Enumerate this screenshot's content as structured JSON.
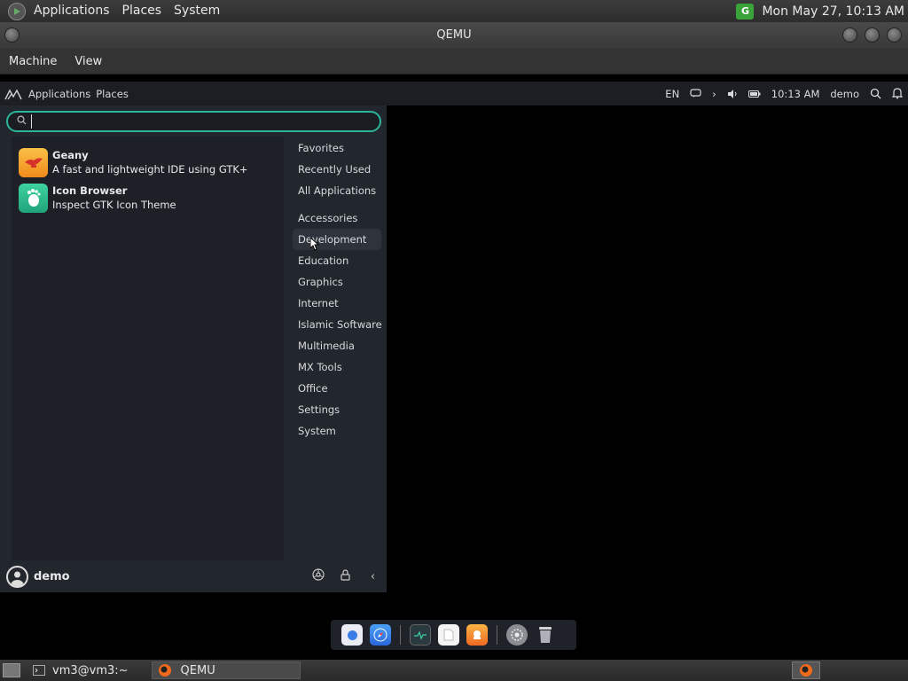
{
  "host_panel": {
    "menus": [
      "Applications",
      "Places",
      "System"
    ],
    "clock": "Mon May 27, 10:13 AM",
    "update_icon": "update-manager-icon"
  },
  "qemu": {
    "title": "QEMU",
    "menus": [
      "Machine",
      "View"
    ]
  },
  "guest_panel": {
    "menus": [
      "Applications",
      "Places"
    ],
    "lang": "EN",
    "time": "10:13 AM",
    "user": "demo"
  },
  "whisker": {
    "search_value": "",
    "results": [
      {
        "name": "Geany",
        "desc": "A fast and lightweight IDE using GTK+",
        "icon": "geany-icon",
        "color": "#f5a623"
      },
      {
        "name": "Icon Browser",
        "desc": "Inspect GTK Icon Theme",
        "icon": "gnome-foot-icon",
        "color": "#2bbf8e"
      }
    ],
    "categories_top": [
      "Favorites",
      "Recently Used",
      "All Applications"
    ],
    "categories": [
      "Accessories",
      "Development",
      "Education",
      "Graphics",
      "Internet",
      "Islamic Software",
      "Multimedia",
      "MX Tools",
      "Office",
      "Settings",
      "System"
    ],
    "active_category": "Development",
    "user": "demo"
  },
  "host_taskbar": {
    "tasks": [
      "vm3@vm3:~",
      "QEMU"
    ]
  },
  "colors": {
    "accent": "#2bb59a",
    "panel": "#1c1e23",
    "menu_bg": "#22262d"
  }
}
